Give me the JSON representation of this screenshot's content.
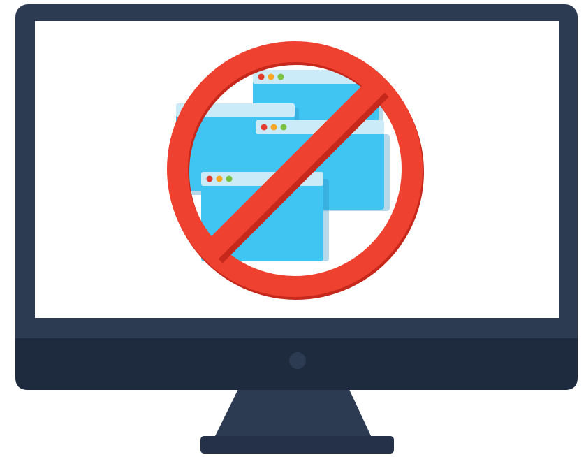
{
  "illustration": {
    "subject": "monitor-with-prohibited-popups",
    "icons": [
      "monitor-icon",
      "browser-window-icon",
      "prohibition-icon",
      "power-button-icon"
    ],
    "colors": {
      "monitor_frame": "#2d3b52",
      "monitor_chin": "#1e2a3e",
      "screen": "#ffffff",
      "window_body": "#40c4f2",
      "window_titlebar": "#ccebf8",
      "window_shadow": "#2a8fc4",
      "prohibition": "#ef4130",
      "prohibition_shadow": "#c6281b",
      "dot_red": "#e53b2f",
      "dot_orange": "#f5a623",
      "dot_green": "#7cc242",
      "stand": "#2d3b52",
      "stand_base": "#243148"
    }
  }
}
